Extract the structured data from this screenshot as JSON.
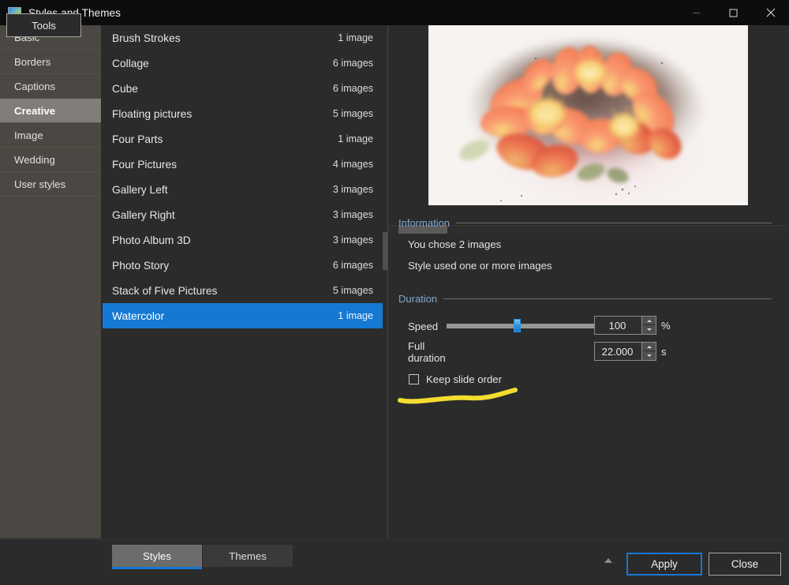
{
  "window": {
    "title": "Styles and Themes",
    "icon": "picture-icon",
    "controls": {
      "minimize": "minimize-icon",
      "maximize": "maximize-icon",
      "close": "close-icon"
    }
  },
  "sidebar": {
    "items": [
      {
        "label": "Basic",
        "selected": false
      },
      {
        "label": "Borders",
        "selected": false
      },
      {
        "label": "Captions",
        "selected": false
      },
      {
        "label": "Creative",
        "selected": true
      },
      {
        "label": "Image",
        "selected": false
      },
      {
        "label": "Wedding",
        "selected": false
      },
      {
        "label": "User styles",
        "selected": false
      }
    ]
  },
  "style_list": {
    "rows": [
      {
        "name": "Brush Strokes",
        "count": "1 image",
        "selected": false
      },
      {
        "name": "Collage",
        "count": "6 images",
        "selected": false
      },
      {
        "name": "Cube",
        "count": "6 images",
        "selected": false
      },
      {
        "name": "Floating pictures",
        "count": "5 images",
        "selected": false
      },
      {
        "name": "Four Parts",
        "count": "1 image",
        "selected": false
      },
      {
        "name": "Four Pictures",
        "count": "4 images",
        "selected": false
      },
      {
        "name": "Gallery Left",
        "count": "3 images",
        "selected": false
      },
      {
        "name": "Gallery Right",
        "count": "3 images",
        "selected": false
      },
      {
        "name": "Photo Album 3D",
        "count": "3 images",
        "selected": false
      },
      {
        "name": "Photo Story",
        "count": "6 images",
        "selected": false
      },
      {
        "name": "Stack of Five Pictures",
        "count": "5 images",
        "selected": false
      },
      {
        "name": "Watercolor",
        "count": "1 image",
        "selected": true
      }
    ]
  },
  "preview": {
    "name": "watercolor-flower-preview",
    "colors": {
      "petal": "#f4774f",
      "petal_light": "#fa9a72",
      "center": "#f6d77a",
      "backdrop": "#4a3228",
      "paper": "#f6f3f1",
      "wash_pink": "#f2b9c2"
    }
  },
  "information": {
    "title": "Information",
    "lines": [
      "You chose 2 images",
      "Style used one or more images"
    ]
  },
  "duration": {
    "title": "Duration",
    "speed": {
      "label": "Speed",
      "value": "100",
      "unit": "%",
      "slider_percent": 48
    },
    "full_duration": {
      "label": "Full duration",
      "value": "22.000",
      "unit": "s"
    },
    "keep_slide_order": {
      "label": "Keep slide order",
      "checked": false
    }
  },
  "annotation": {
    "name": "yellow-underline",
    "color": "#f2dd30"
  },
  "bottom": {
    "tools_label": "Tools",
    "tabs": [
      {
        "label": "Styles",
        "active": true
      },
      {
        "label": "Themes",
        "active": false
      }
    ],
    "collapse_icon": "triangle-up-icon",
    "apply_label": "Apply",
    "close_label": "Close"
  },
  "theme": {
    "accent": "#1579d4",
    "selection": "#1579d4",
    "group_title": "#7fa8cc",
    "sidebar_bg": "#4b4742",
    "panel_bg": "#2b2b2b",
    "titlebar_bg": "#0d0d0d"
  }
}
